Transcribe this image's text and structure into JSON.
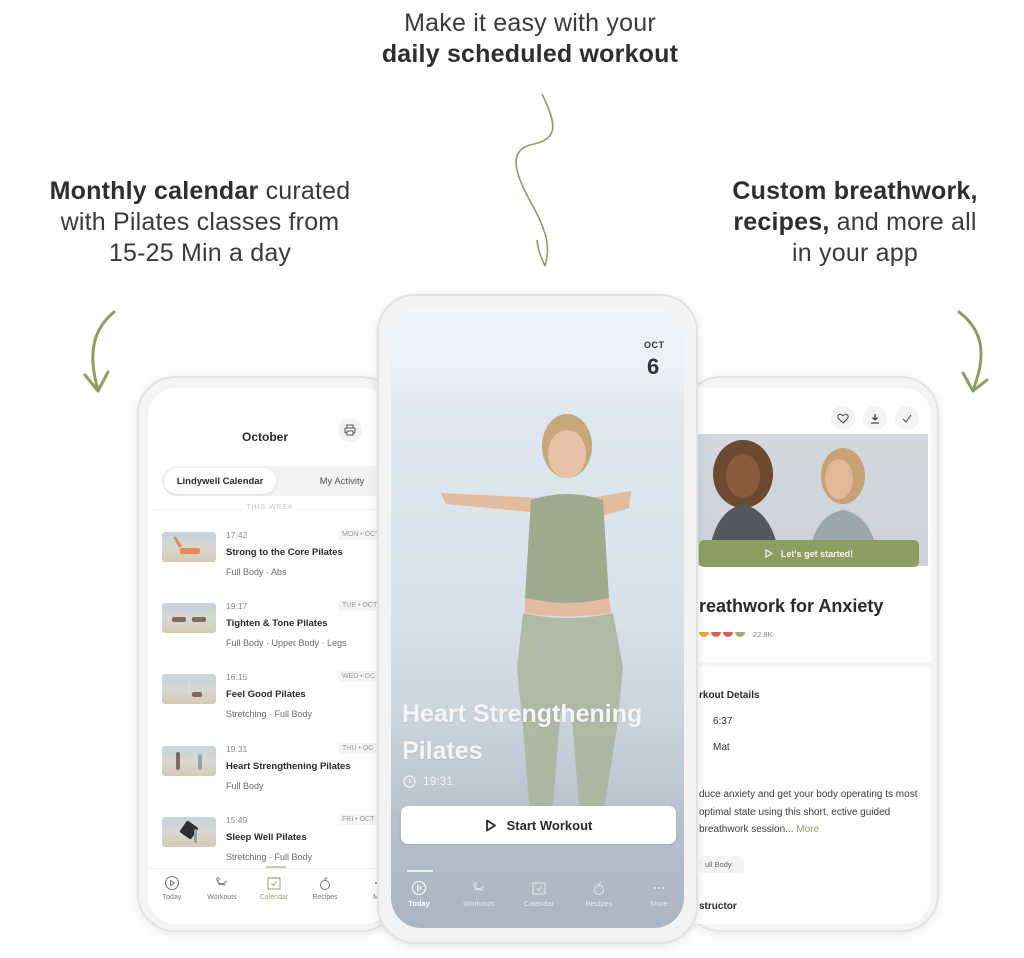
{
  "captions": {
    "top": {
      "line1": "Make it easy with your",
      "line2_bold": "daily scheduled workout"
    },
    "left": {
      "bold": "Monthly calendar",
      "rest1": " curated",
      "line2": "with Pilates classes from",
      "line3": "15-25 Min a day"
    },
    "right": {
      "bold1": "Custom breathwork,",
      "bold2": "recipes,",
      "rest2": " and more all",
      "line3": "in your app"
    }
  },
  "accent_color": "#8d9e62",
  "calendar_screen": {
    "title": "October",
    "print_icon": "printer-icon",
    "segments": {
      "active": "Lindywell Calendar",
      "inactive": "My Activity"
    },
    "section_label": "THIS WEEK",
    "workouts": [
      {
        "time": "17:42",
        "day": "MON • OCT",
        "title": "Strong to the Core Pilates",
        "tags": "Full Body · Abs"
      },
      {
        "time": "19:17",
        "day": "TUE • OCT",
        "title": "Tighten & Tone Pilates",
        "tags": "Full Body · Upper Body · Legs"
      },
      {
        "time": "16:15",
        "day": "WED • OC",
        "title": "Feel Good Pilates",
        "tags": "Stretching · Full Body"
      },
      {
        "time": "19:31",
        "day": "THU • OC",
        "title": "Heart Strengthening Pilates",
        "tags": "Full Body"
      },
      {
        "time": "15:49",
        "day": "FRI • OCT",
        "title": "Sleep Well Pilates",
        "tags": "Stretching · Full Body"
      }
    ],
    "nav": [
      {
        "label": "Today",
        "icon": "play-circle-icon"
      },
      {
        "label": "Workouts",
        "icon": "workouts-icon"
      },
      {
        "label": "Calendar",
        "icon": "calendar-check-icon",
        "active": true
      },
      {
        "label": "Recipes",
        "icon": "apple-icon"
      },
      {
        "label": "M",
        "icon": "more-icon"
      }
    ]
  },
  "today_screen": {
    "month": "OCT",
    "day": "6",
    "title": "Heart Strengthening Pilates",
    "duration": "19:31",
    "start_label": "Start Workout",
    "nav": [
      {
        "label": "Today",
        "icon": "play-circle-icon",
        "active": true
      },
      {
        "label": "Workouts",
        "icon": "workouts-icon"
      },
      {
        "label": "Calendar",
        "icon": "calendar-check-icon"
      },
      {
        "label": "Recipes",
        "icon": "apple-icon"
      },
      {
        "label": "More",
        "icon": "more-icon"
      }
    ]
  },
  "detail_screen": {
    "actions": [
      "heart-icon",
      "download-icon",
      "check-icon"
    ],
    "cta_label": "Let's get started!",
    "title": "reathwork for Anxiety",
    "rating_count": "22.8K",
    "details_heading": "rkout Details",
    "duration": "6:37",
    "equipment": "Mat",
    "description": "duce anxiety and get your body operating ts most optimal state using this short, ective guided breathwork session...",
    "more_label": "More",
    "tag": "ull Body",
    "instructor_heading": "structor"
  }
}
